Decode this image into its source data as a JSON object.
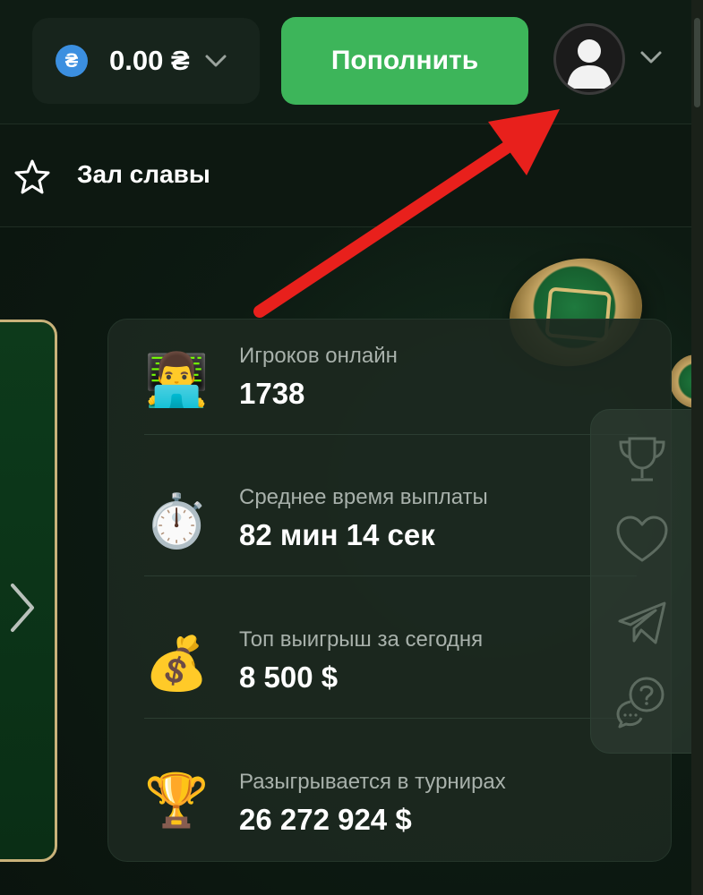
{
  "header": {
    "currency_symbol": "₴",
    "balance": "0.00 ₴",
    "deposit_label": "Пополнить"
  },
  "nav": {
    "hall_of_fame": "Зал славы"
  },
  "stats": [
    {
      "icon": "person-laptop-icon",
      "emoji": "👨‍💻",
      "label": "Игроков онлайн",
      "value": "1738"
    },
    {
      "icon": "stopwatch-icon",
      "emoji": "⏱️",
      "label": "Среднее время выплаты",
      "value": "82 мин 14 сек"
    },
    {
      "icon": "money-bag-icon",
      "emoji": "💰",
      "label": "Топ выигрыш за сегодня",
      "value": "8 500 $"
    },
    {
      "icon": "trophy-icon",
      "emoji": "🏆",
      "label": "Разыгрывается в турнирах",
      "value": "26 272 924 $"
    }
  ],
  "side_panel": [
    "trophy-icon",
    "heart-icon",
    "telegram-icon",
    "support-chat-icon"
  ],
  "colors": {
    "accent": "#3db55a",
    "background": "#0d1a12",
    "annotation_arrow": "#e8201c"
  }
}
